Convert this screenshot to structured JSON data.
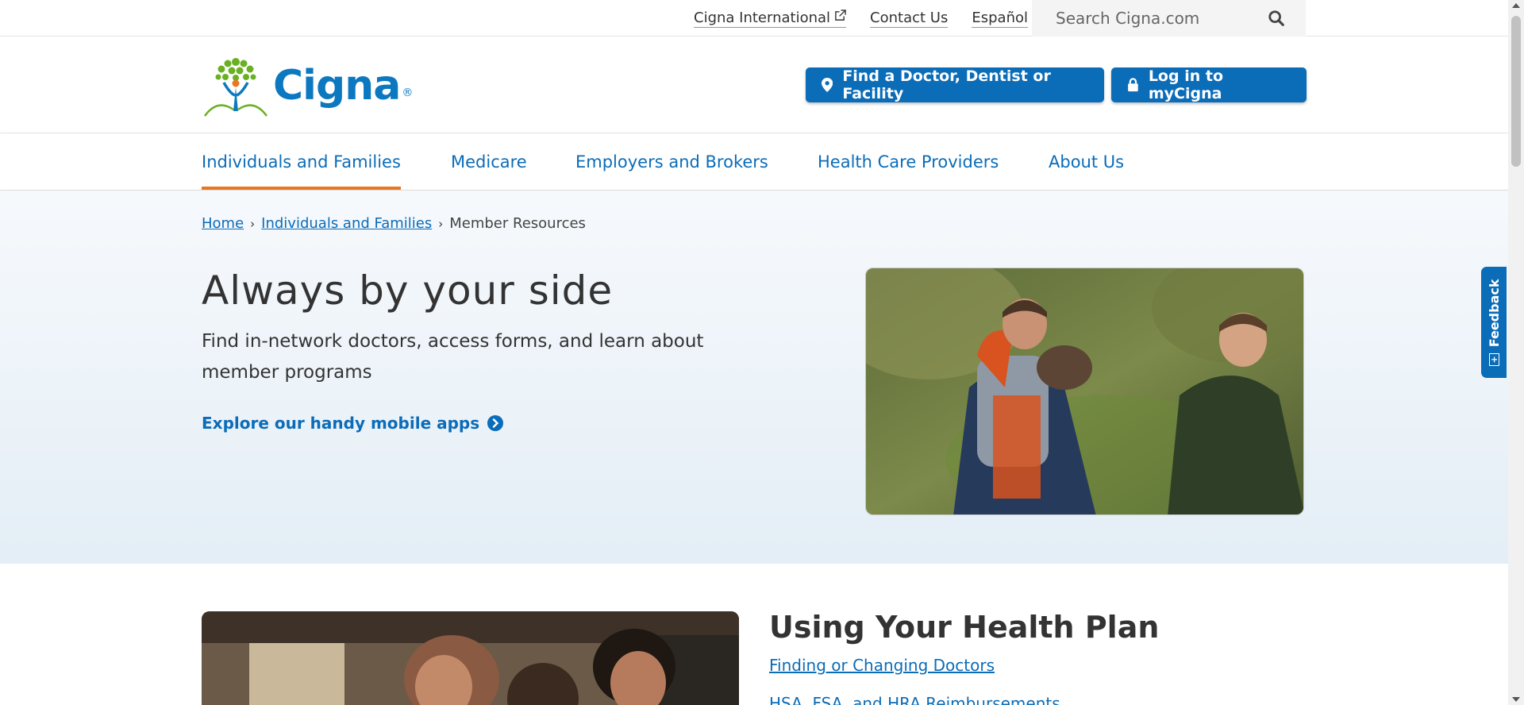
{
  "utility": {
    "international": "Cigna International",
    "contact": "Contact Us",
    "espanol": "Español",
    "search_placeholder": "Search Cigna.com"
  },
  "header": {
    "logo_text": "Cigna",
    "logo_reg": "®",
    "find_button": "Find a Doctor, Dentist or Facility",
    "login_button": "Log in to myCigna"
  },
  "nav": {
    "items": [
      {
        "label": "Individuals and Families",
        "active": true
      },
      {
        "label": "Medicare"
      },
      {
        "label": "Employers and Brokers"
      },
      {
        "label": "Health Care Providers"
      },
      {
        "label": "About Us"
      }
    ]
  },
  "breadcrumb": {
    "home": "Home",
    "section": "Individuals and Families",
    "current": "Member Resources"
  },
  "hero": {
    "title": "Always by your side",
    "subtitle": "Find in-network doctors, access forms, and learn about member programs",
    "link": "Explore our handy mobile apps"
  },
  "health_plan": {
    "title": "Using Your Health Plan",
    "links": [
      "Finding or Changing Doctors",
      "HSA, FSA, and HRA Reimbursements"
    ]
  },
  "feedback": {
    "label": "Feedback"
  },
  "colors": {
    "brand_blue": "#0b6cb8",
    "accent_orange": "#e87722"
  }
}
